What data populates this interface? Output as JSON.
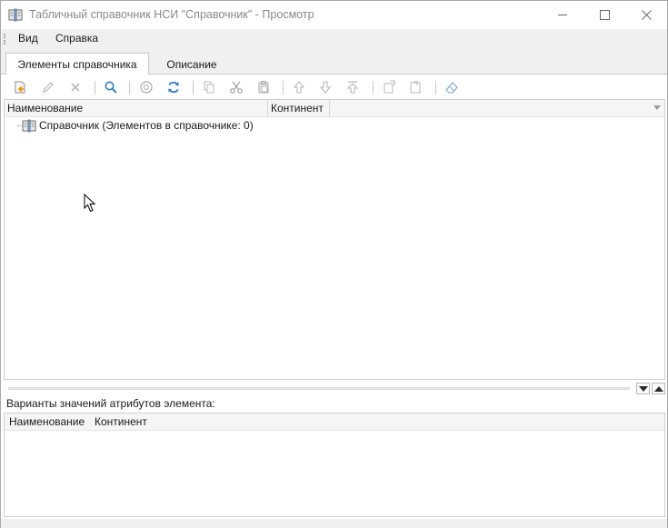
{
  "window": {
    "title": "Табличный справочник НСИ \"Справочник\" - Просмотр",
    "controls": {
      "minimize": "minimize",
      "maximize": "maximize",
      "close": "close"
    }
  },
  "menu": {
    "items": [
      {
        "label": "Вид"
      },
      {
        "label": "Справка"
      }
    ]
  },
  "tabs": [
    {
      "label": "Элементы справочника",
      "active": true
    },
    {
      "label": "Описание",
      "active": false
    }
  ],
  "toolbar": {
    "buttons": [
      {
        "icon": "new-element-icon",
        "enabled": true
      },
      {
        "icon": "edit-icon",
        "enabled": false
      },
      {
        "icon": "delete-icon",
        "enabled": false
      },
      {
        "icon": "search-icon",
        "enabled": true
      },
      {
        "icon": "find-value-icon",
        "enabled": false
      },
      {
        "icon": "refresh-icon",
        "enabled": true
      },
      {
        "icon": "copy-icon",
        "enabled": false
      },
      {
        "icon": "cut-icon",
        "enabled": false
      },
      {
        "icon": "paste-icon",
        "enabled": false
      },
      {
        "icon": "move-up-icon",
        "enabled": false
      },
      {
        "icon": "move-down-icon",
        "enabled": false
      },
      {
        "icon": "move-to-top-icon",
        "enabled": false
      },
      {
        "icon": "export-icon",
        "enabled": false
      },
      {
        "icon": "import-icon",
        "enabled": false
      },
      {
        "icon": "eraser-icon",
        "enabled": false
      }
    ]
  },
  "elements_grid": {
    "columns": [
      "Наименование",
      "Континент"
    ],
    "rows": [
      {
        "label": "Справочник (Элементов в справочнике: 0)",
        "icon": "book-icon"
      }
    ]
  },
  "variants": {
    "label": "Варианты значений атрибутов элемента:",
    "columns": [
      "Наименование",
      "Континент"
    ]
  },
  "colors": {
    "icon_blue": "#2f7fc1",
    "icon_disabled": "#b8b8b8",
    "window_bg": "#f0f0f0"
  }
}
